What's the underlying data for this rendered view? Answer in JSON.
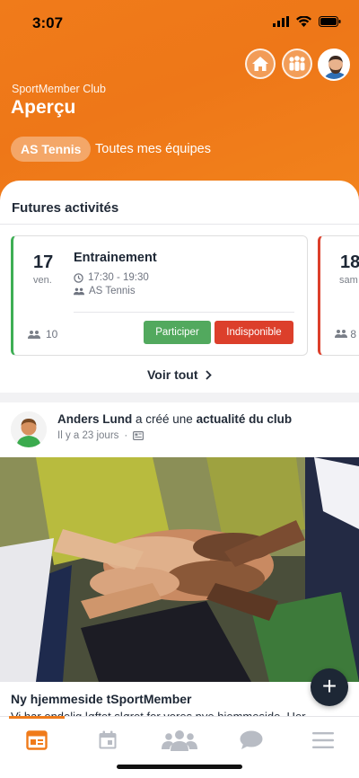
{
  "status_bar": {
    "time": "3:07"
  },
  "header": {
    "club_name": "SportMember Club",
    "title": "Aperçu",
    "filters": [
      {
        "label": "AS Tennis",
        "active": true
      },
      {
        "label": "Toutes mes équipes",
        "active": false
      }
    ],
    "icons": [
      "home-icon",
      "team-icon",
      "avatar"
    ]
  },
  "activities": {
    "title": "Futures activités",
    "cards": [
      {
        "day": "17",
        "weekday": "ven.",
        "title": "Entrainement",
        "time": "17:30 - 19:30",
        "team": "AS Tennis",
        "participants": "10",
        "participate_label": "Participer",
        "unavailable_label": "Indisponible"
      },
      {
        "day": "18",
        "weekday": "sam",
        "participants": "8"
      }
    ],
    "see_all": "Voir tout"
  },
  "post": {
    "author": "Anders Lund",
    "action": "a créé une",
    "object": "actualité du club",
    "time_ago": "Il y a 23 jours",
    "title": "Ny hjemmeside tSportMember",
    "excerpt": "Vi har endelig løftet sløret for vores nye hjemmeside. Her"
  },
  "fab": {
    "label": "+"
  },
  "tabs": [
    "overview-icon",
    "calendar-icon",
    "members-icon",
    "chat-icon",
    "menu-icon"
  ],
  "colors": {
    "brand_orange": "#f07b1a",
    "navy": "#1d2735",
    "green": "#52a95e",
    "red": "#dc3f2b"
  }
}
